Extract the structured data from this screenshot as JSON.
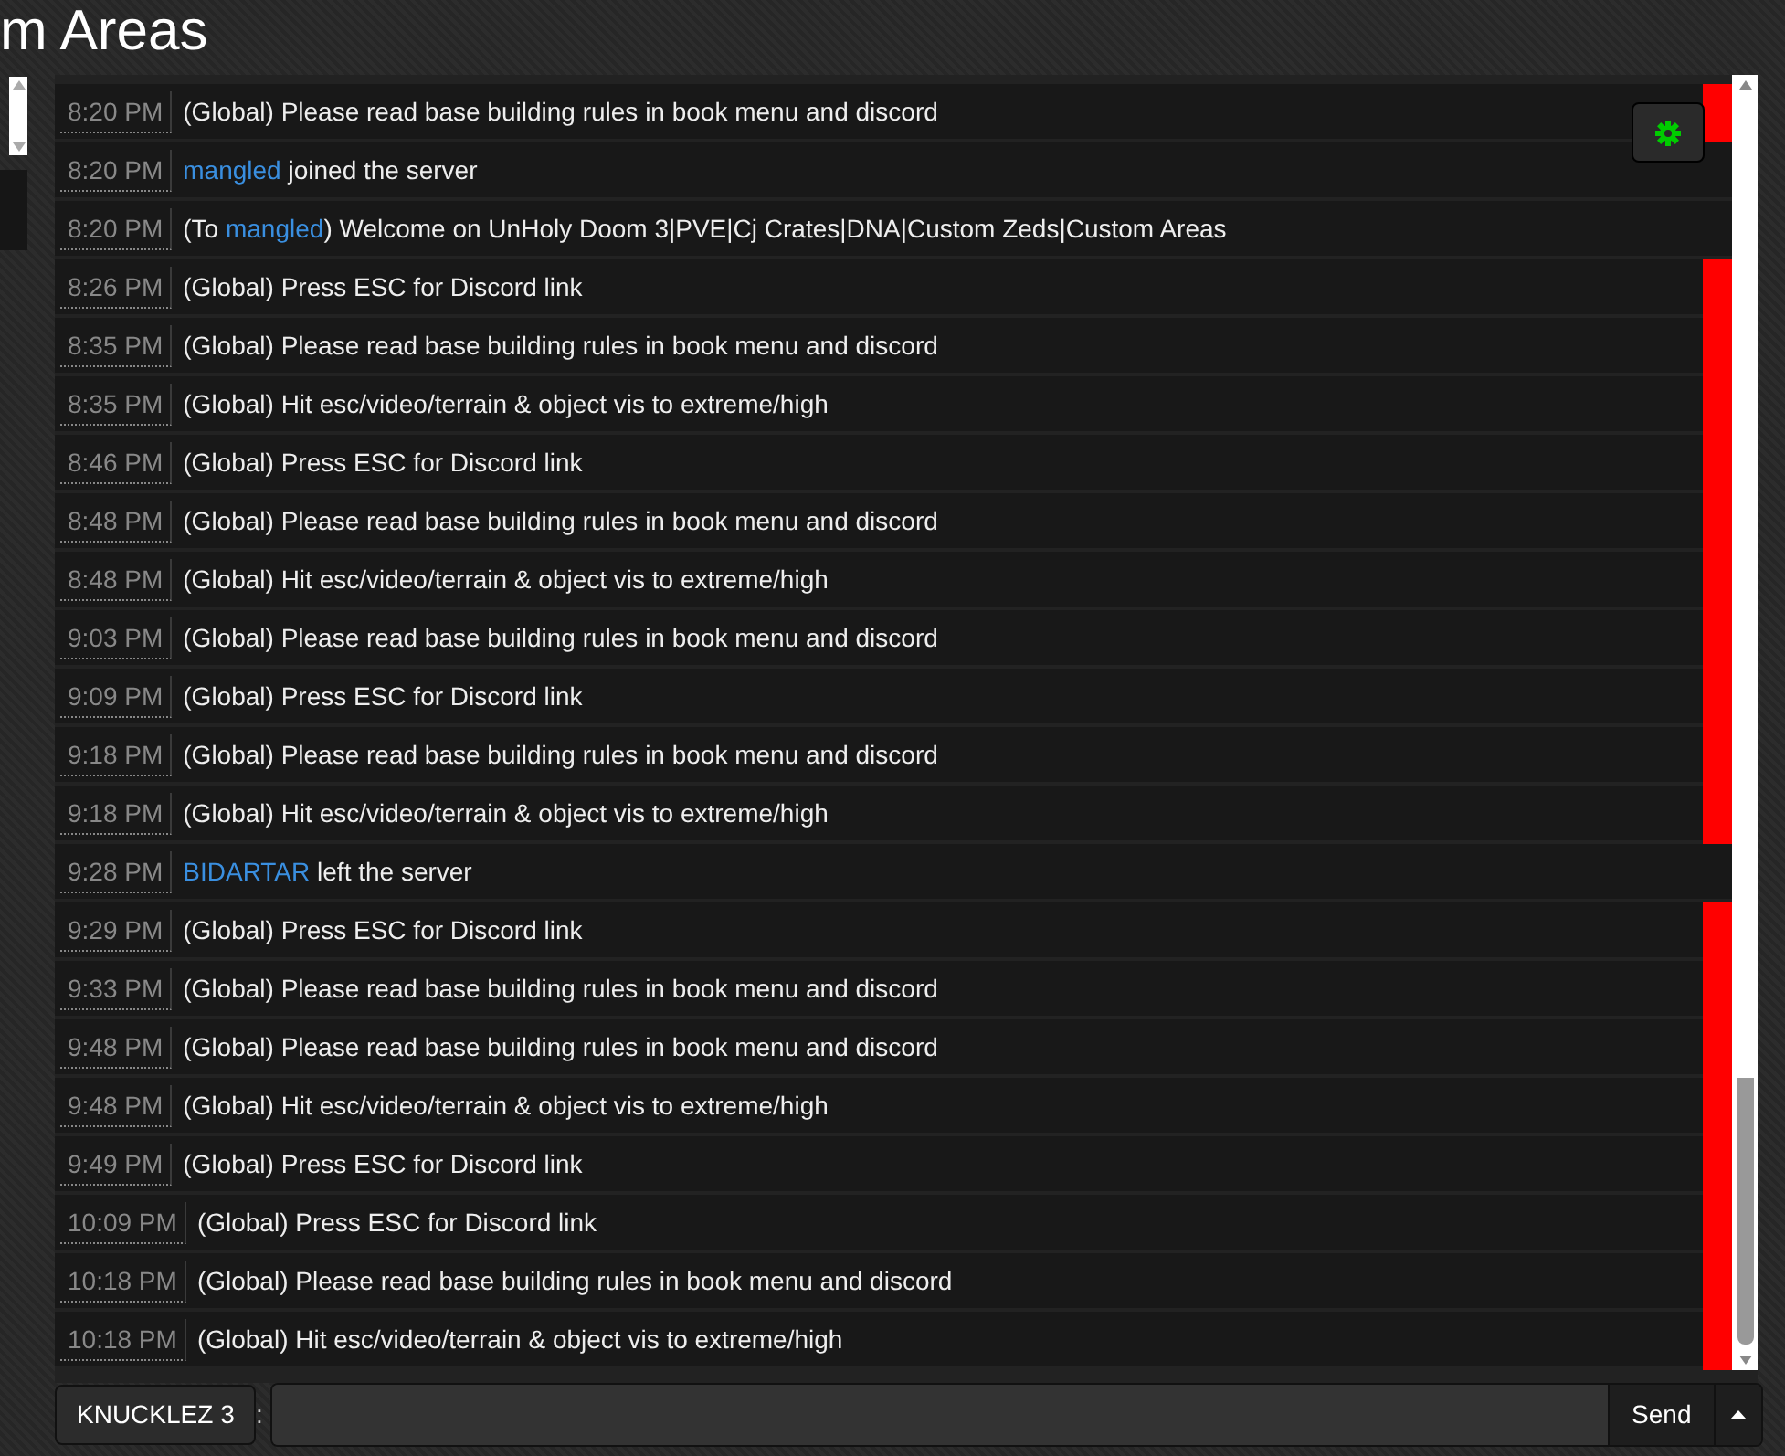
{
  "title": "m Areas",
  "messages": [
    {
      "time": "8:20 PM",
      "flagged": true,
      "parts": [
        {
          "kind": "plain",
          "text": "(Global) Please read base building rules in book menu and discord"
        }
      ]
    },
    {
      "time": "8:20 PM",
      "flagged": false,
      "parts": [
        {
          "kind": "player",
          "text": "mangled"
        },
        {
          "kind": "plain",
          "text": " joined the server"
        }
      ]
    },
    {
      "time": "8:20 PM",
      "flagged": false,
      "parts": [
        {
          "kind": "plain",
          "text": "(To "
        },
        {
          "kind": "player",
          "text": "mangled"
        },
        {
          "kind": "plain",
          "text": ") Welcome on UnHoly Doom 3|PVE|Cj Crates|DNA|Custom Zeds|Custom Areas"
        }
      ]
    },
    {
      "time": "8:26 PM",
      "flagged": true,
      "parts": [
        {
          "kind": "plain",
          "text": "(Global) Press ESC for Discord link"
        }
      ]
    },
    {
      "time": "8:35 PM",
      "flagged": true,
      "parts": [
        {
          "kind": "plain",
          "text": "(Global) Please read base building rules in book menu and discord"
        }
      ]
    },
    {
      "time": "8:35 PM",
      "flagged": true,
      "parts": [
        {
          "kind": "plain",
          "text": "(Global) Hit esc/video/terrain & object vis to extreme/high"
        }
      ]
    },
    {
      "time": "8:46 PM",
      "flagged": true,
      "parts": [
        {
          "kind": "plain",
          "text": "(Global) Press ESC for Discord link"
        }
      ]
    },
    {
      "time": "8:48 PM",
      "flagged": true,
      "parts": [
        {
          "kind": "plain",
          "text": "(Global) Please read base building rules in book menu and discord"
        }
      ]
    },
    {
      "time": "8:48 PM",
      "flagged": true,
      "parts": [
        {
          "kind": "plain",
          "text": "(Global) Hit esc/video/terrain & object vis to extreme/high"
        }
      ]
    },
    {
      "time": "9:03 PM",
      "flagged": true,
      "parts": [
        {
          "kind": "plain",
          "text": "(Global) Please read base building rules in book menu and discord"
        }
      ]
    },
    {
      "time": "9:09 PM",
      "flagged": true,
      "parts": [
        {
          "kind": "plain",
          "text": "(Global) Press ESC for Discord link"
        }
      ]
    },
    {
      "time": "9:18 PM",
      "flagged": true,
      "parts": [
        {
          "kind": "plain",
          "text": "(Global) Please read base building rules in book menu and discord"
        }
      ]
    },
    {
      "time": "9:18 PM",
      "flagged": true,
      "parts": [
        {
          "kind": "plain",
          "text": "(Global) Hit esc/video/terrain & object vis to extreme/high"
        }
      ]
    },
    {
      "time": "9:28 PM",
      "flagged": false,
      "parts": [
        {
          "kind": "player",
          "text": "BIDARTAR"
        },
        {
          "kind": "plain",
          "text": " left the server"
        }
      ]
    },
    {
      "time": "9:29 PM",
      "flagged": true,
      "parts": [
        {
          "kind": "plain",
          "text": "(Global) Press ESC for Discord link"
        }
      ]
    },
    {
      "time": "9:33 PM",
      "flagged": true,
      "parts": [
        {
          "kind": "plain",
          "text": "(Global) Please read base building rules in book menu and discord"
        }
      ]
    },
    {
      "time": "9:48 PM",
      "flagged": true,
      "parts": [
        {
          "kind": "plain",
          "text": "(Global) Please read base building rules in book menu and discord"
        }
      ]
    },
    {
      "time": "9:48 PM",
      "flagged": true,
      "parts": [
        {
          "kind": "plain",
          "text": "(Global) Hit esc/video/terrain & object vis to extreme/high"
        }
      ]
    },
    {
      "time": "9:49 PM",
      "flagged": true,
      "parts": [
        {
          "kind": "plain",
          "text": "(Global) Press ESC for Discord link"
        }
      ]
    },
    {
      "time": "10:09 PM",
      "flagged": true,
      "parts": [
        {
          "kind": "plain",
          "text": "(Global) Press ESC for Discord link"
        }
      ]
    },
    {
      "time": "10:18 PM",
      "flagged": true,
      "parts": [
        {
          "kind": "plain",
          "text": "(Global) Please read base building rules in book menu and discord"
        }
      ]
    },
    {
      "time": "10:18 PM",
      "flagged": true,
      "parts": [
        {
          "kind": "plain",
          "text": "(Global) Hit esc/video/terrain & object vis to extreme/high"
        }
      ]
    }
  ],
  "composer": {
    "name": "KNUCKLEZ 3",
    "separator": ":",
    "send": "Send"
  }
}
